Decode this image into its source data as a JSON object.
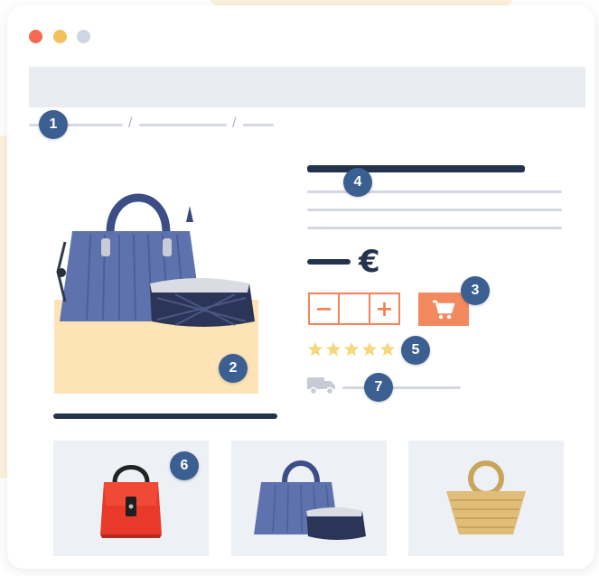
{
  "window": {
    "controls": [
      "close",
      "minimize",
      "zoom"
    ]
  },
  "breadcrumb": {
    "separator": "/"
  },
  "product": {
    "currency_symbol": "€",
    "quantity": {
      "minus_label": "−",
      "plus_label": "+",
      "value": ""
    },
    "rating": {
      "stars": 5,
      "max": 5
    }
  },
  "badges": {
    "breadcrumb": "1",
    "image": "2",
    "cart": "3",
    "title": "4",
    "rating": "5",
    "related": "6",
    "delivery": "7"
  },
  "icons": {
    "cart": "shopping-cart-icon",
    "delivery": "delivery-truck-icon",
    "star": "star-icon"
  },
  "colors": {
    "accent": "#f3895f",
    "badge": "#3c5f91",
    "dark": "#24334d",
    "star": "#f6d77b",
    "image_bg": "#fde3b6",
    "placeholder": "#e9ecf1"
  }
}
